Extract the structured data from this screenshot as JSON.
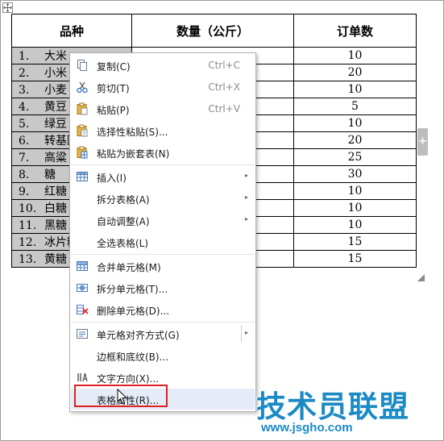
{
  "table": {
    "headers": [
      "品种",
      "数量（公斤）",
      "订单数"
    ],
    "rows": [
      [
        "1.",
        "大米",
        "10"
      ],
      [
        "2.",
        "小米",
        "20"
      ],
      [
        "3.",
        "小麦",
        "10"
      ],
      [
        "4.",
        "黄豆",
        "5"
      ],
      [
        "5.",
        "绿豆",
        "10"
      ],
      [
        "6.",
        "转基因",
        "20"
      ],
      [
        "7.",
        "高粱",
        "25"
      ],
      [
        "8.",
        "糖",
        "30"
      ],
      [
        "9.",
        "红糖",
        "10"
      ],
      [
        "10.",
        "白糖",
        "10"
      ],
      [
        "11.",
        "黑糖",
        "10"
      ],
      [
        "12.",
        "冰片糖",
        "15"
      ],
      [
        "13.",
        "黄糖",
        "15"
      ]
    ]
  },
  "side_tab": {
    "glyph": "+"
  },
  "menu": {
    "items": [
      {
        "label": "复制(C)",
        "shortcut": "Ctrl+C",
        "icon": "copy-icon"
      },
      {
        "label": "剪切(T)",
        "shortcut": "Ctrl+X",
        "icon": "scissors-icon"
      },
      {
        "label": "粘贴(P)",
        "shortcut": "Ctrl+V",
        "icon": "paste-icon"
      },
      {
        "label": "选择性粘贴(S)...",
        "shortcut": "",
        "icon": "paste-special-icon"
      },
      {
        "label": "粘贴为嵌套表(N)",
        "shortcut": "",
        "icon": "paste-nested-table-icon"
      },
      {
        "label": "插入(I)",
        "shortcut": "",
        "icon": "table-insert-icon",
        "submenu": true
      },
      {
        "label": "拆分表格(A)",
        "shortcut": "",
        "icon": "",
        "submenu": true
      },
      {
        "label": "自动调整(A)",
        "shortcut": "",
        "icon": "",
        "submenu": true
      },
      {
        "label": "全选表格(L)",
        "shortcut": "",
        "icon": ""
      },
      {
        "label": "合并单元格(M)",
        "shortcut": "",
        "icon": "merge-cells-icon"
      },
      {
        "label": "拆分单元格(T)...",
        "shortcut": "",
        "icon": "split-cells-icon"
      },
      {
        "label": "删除单元格(D)...",
        "shortcut": "",
        "icon": "delete-cells-icon"
      },
      {
        "label": "单元格对齐方式(G)",
        "shortcut": "",
        "icon": "align-icon",
        "submenu": true
      },
      {
        "label": "边框和底纹(B)...",
        "shortcut": "",
        "icon": ""
      },
      {
        "label": "文字方向(X)...",
        "shortcut": "",
        "icon": "text-direction-icon"
      },
      {
        "label": "表格属性(R)...",
        "shortcut": "",
        "icon": "",
        "highlighted": true
      }
    ],
    "submenu_arrow": "▸"
  },
  "watermark": {
    "title": "技术员联盟",
    "url": "www.jsgho.com"
  },
  "colors": {
    "highlight": "#e6ebf8",
    "redbox": "#e02020",
    "watermark": "#1c8ac4",
    "first_col_bg": "#c8c8c8"
  }
}
